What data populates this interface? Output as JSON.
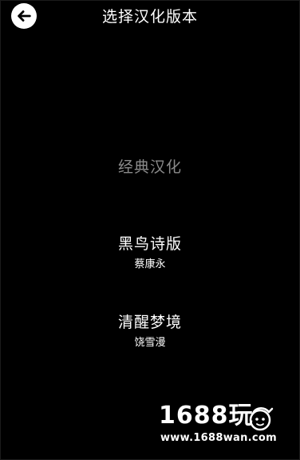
{
  "header": {
    "title": "选择汉化版本",
    "back_icon": "arrow-left-icon"
  },
  "versions": [
    {
      "name": "经典汉化",
      "author": "",
      "state": "dimmed"
    },
    {
      "name": "黑鸟诗版",
      "author": "蔡康永",
      "state": "normal"
    },
    {
      "name": "清醒梦境",
      "author": "饶雪漫",
      "state": "normal"
    }
  ],
  "watermark": {
    "logo_text": "1688玩",
    "url": "www.1688wan.com"
  },
  "colors": {
    "background": "#000000",
    "text": "#ffffff",
    "dimmed_text": "#8a8a8a"
  }
}
